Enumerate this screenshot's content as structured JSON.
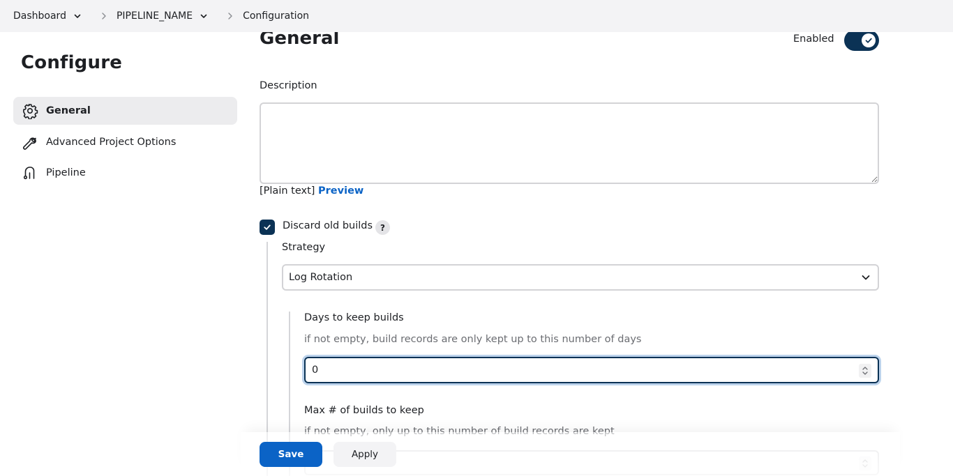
{
  "breadcrumb": {
    "items": [
      {
        "label": "Dashboard",
        "has_dropdown": true
      },
      {
        "label": "PIPELINE_NAME",
        "has_dropdown": true
      },
      {
        "label": "Configuration",
        "has_dropdown": false
      }
    ]
  },
  "sidebar": {
    "title": "Configure",
    "items": [
      {
        "label": "General",
        "icon": "gear-icon",
        "active": true
      },
      {
        "label": "Advanced Project Options",
        "icon": "wrench-icon",
        "active": false
      },
      {
        "label": "Pipeline",
        "icon": "pipeline-icon",
        "active": false
      }
    ]
  },
  "general": {
    "title": "General",
    "enabled_label": "Enabled",
    "enabled": true,
    "description_label": "Description",
    "description_value": "",
    "plain_text_label": "[Plain text]",
    "preview_label": "Preview",
    "discard_old_builds_label": "Discard old builds",
    "discard_old_builds_checked": true,
    "help_mark": "?",
    "strategy_label": "Strategy",
    "strategy_value": "Log Rotation",
    "days_to_keep_label": "Days to keep builds",
    "days_to_keep_help": "if not empty, build records are only kept up to this number of days",
    "days_to_keep_value": "0",
    "max_builds_label": "Max # of builds to keep",
    "max_builds_help": "if not empty, only up to this number of build records are kept",
    "max_builds_value": ""
  },
  "actions": {
    "save_label": "Save",
    "apply_label": "Apply"
  },
  "colors": {
    "accent": "#0b63c6",
    "toggle_on": "#0b3255",
    "topbar_bg": "#f3f3f5"
  }
}
